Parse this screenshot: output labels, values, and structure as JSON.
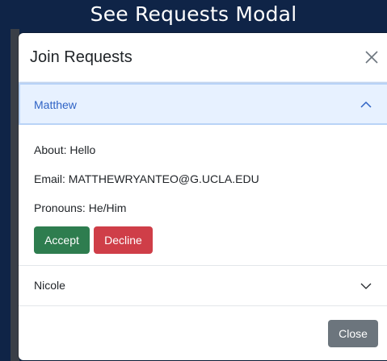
{
  "page": {
    "heading": "See Requests Modal"
  },
  "modal": {
    "title": "Join Requests",
    "close_icon": "close-icon",
    "requests": [
      {
        "name": "Matthew",
        "expanded": true,
        "about": "About: Hello",
        "email": "Email: MATTHEWRYANTEO@G.UCLA.EDU",
        "pronouns": "Pronouns: He/Him",
        "accept_label": "Accept",
        "decline_label": "Decline"
      },
      {
        "name": "Nicole",
        "expanded": false
      }
    ],
    "footer": {
      "close_label": "Close"
    }
  },
  "colors": {
    "background": "#0f2447",
    "accordion_active_bg": "#e7f1ff",
    "accordion_active_text": "#2f63c5",
    "accept": "#2e7d4f",
    "decline": "#cf3e48",
    "close_button": "#6c757d"
  }
}
